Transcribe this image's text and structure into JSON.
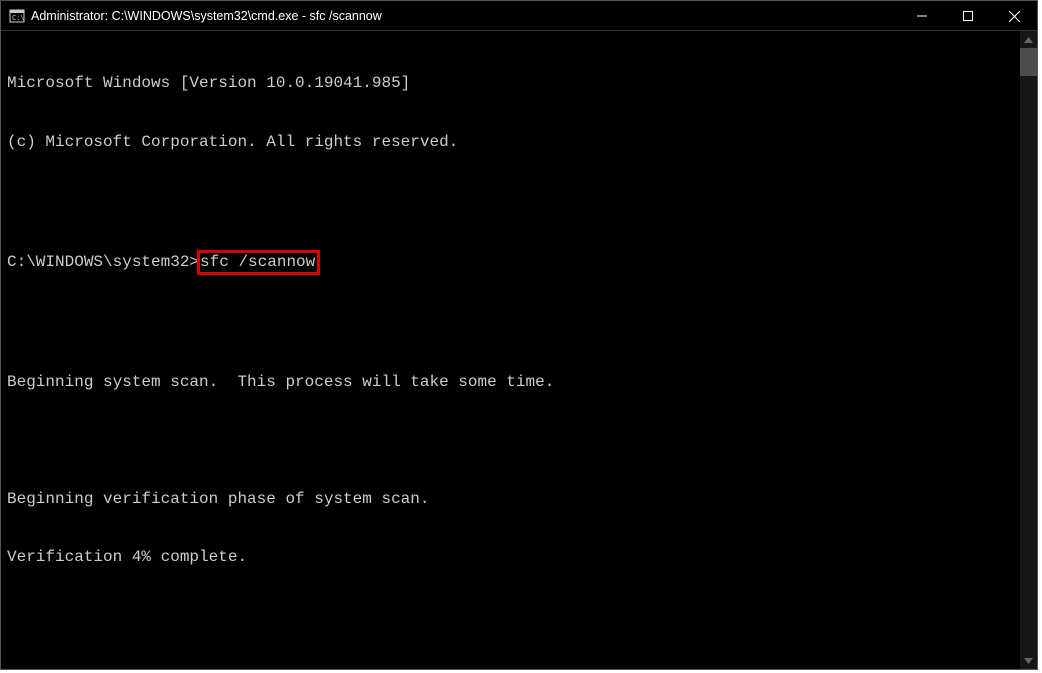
{
  "titlebar": {
    "title": "Administrator: C:\\WINDOWS\\system32\\cmd.exe - sfc  /scannow"
  },
  "terminal": {
    "line1": "Microsoft Windows [Version 10.0.19041.985]",
    "line2": "(c) Microsoft Corporation. All rights reserved.",
    "prompt": "C:\\WINDOWS\\system32>",
    "command": "sfc /scannow",
    "scan_msg": "Beginning system scan.  This process will take some time.",
    "verify_msg": "Beginning verification phase of system scan.",
    "progress_msg": "Verification 4% complete."
  }
}
